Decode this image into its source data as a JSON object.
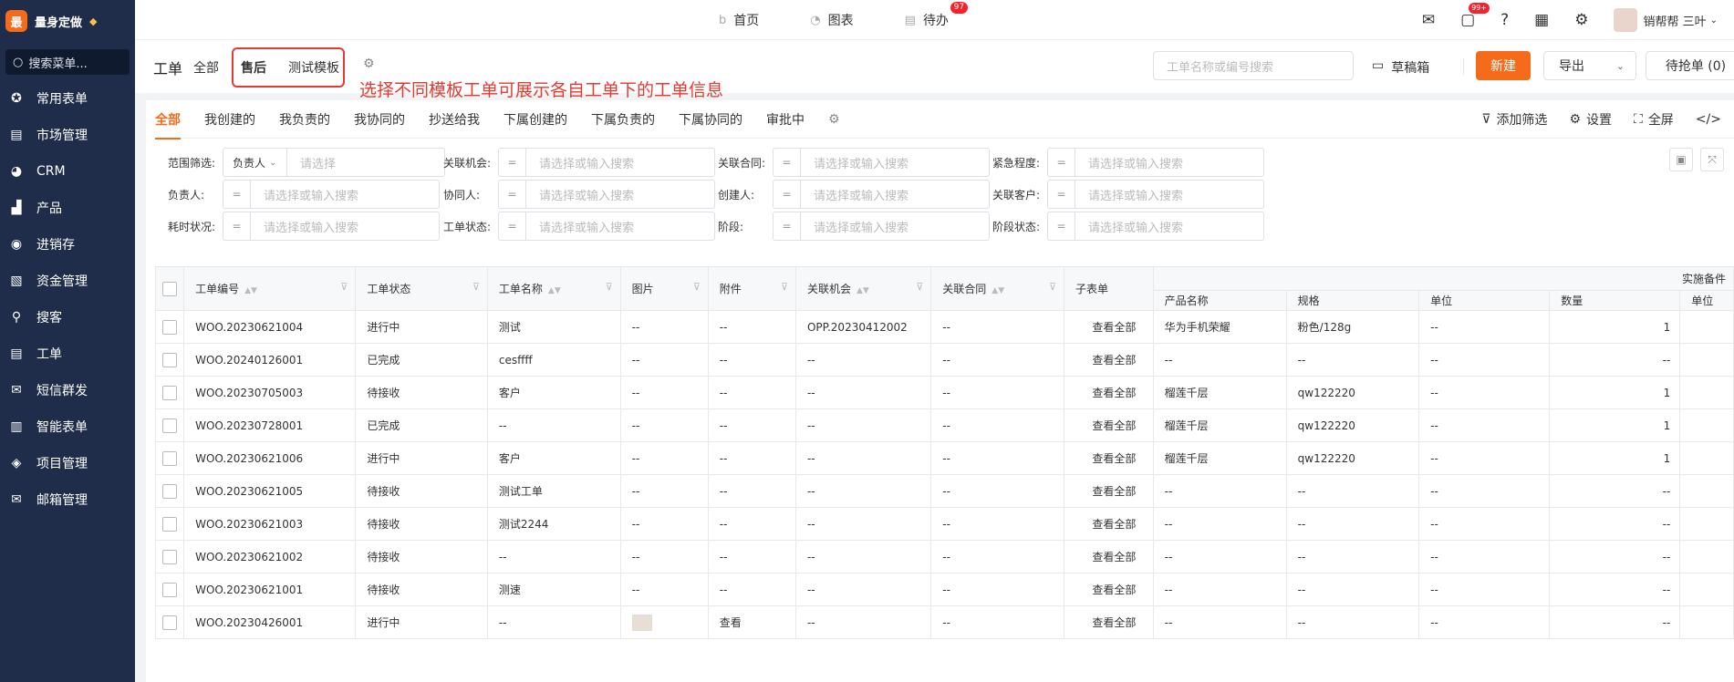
{
  "sidebar": {
    "logo_char": "最",
    "brand": "量身定做",
    "search": "搜索菜单...",
    "items": [
      {
        "label": "常用表单",
        "icon": "star-icon"
      },
      {
        "label": "市场管理",
        "icon": "clipboard-icon"
      },
      {
        "label": "CRM",
        "icon": "pie-icon"
      },
      {
        "label": "产品",
        "icon": "box-icon"
      },
      {
        "label": "进销存",
        "icon": "inventory-icon"
      },
      {
        "label": "资金管理",
        "icon": "finance-icon"
      },
      {
        "label": "搜客",
        "icon": "search-icon"
      },
      {
        "label": "工单",
        "icon": "ticket-icon"
      },
      {
        "label": "短信群发",
        "icon": "sms-icon"
      },
      {
        "label": "智能表单",
        "icon": "form-icon"
      },
      {
        "label": "项目管理",
        "icon": "layers-icon"
      },
      {
        "label": "邮箱管理",
        "icon": "mail-icon"
      }
    ]
  },
  "topnav": {
    "home": "首页",
    "chart": "图表",
    "todo": "待办",
    "todo_badge": "97"
  },
  "topright": {
    "msg_badge": "99+",
    "user": "销帮帮 三叶"
  },
  "header": {
    "title": "工单",
    "all": "全部",
    "tab_active": "售后",
    "tab_test": "测试模板",
    "annotation": "选择不同模板工单可展示各自工单下的工单信息",
    "search_placeholder": "工单名称或编号搜索",
    "draft": "草稿箱",
    "new": "新建",
    "export": "导出",
    "grab": "待抢单 (0)"
  },
  "tabs": [
    "全部",
    "我创建的",
    "我负责的",
    "我协同的",
    "抄送给我",
    "下属创建的",
    "下属负责的",
    "下属协同的",
    "审批中"
  ],
  "tabs_right": {
    "filter": "添加筛选",
    "settings": "设置",
    "fullscreen": "全屏"
  },
  "filters": {
    "scope_label": "范围筛选:",
    "scope_select": "负责人",
    "scope_placeholder": "请选择",
    "op": "=",
    "placeholder": "请选择或输入搜索",
    "labels": [
      "关联机会:",
      "关联合同:",
      "紧急程度:",
      "负责人:",
      "协同人:",
      "创建人:",
      "关联客户:",
      "耗时状况:",
      "工单状态:",
      "阶段:",
      "阶段状态:"
    ]
  },
  "table": {
    "group_header": "实施备件",
    "headers": [
      "工单编号",
      "工单状态",
      "工单名称",
      "图片",
      "附件",
      "关联机会",
      "关联合同",
      "子表单",
      "产品名称",
      "规格",
      "单位",
      "数量",
      "单位"
    ],
    "rows": [
      {
        "id": "WOO.20230621004",
        "status": "进行中",
        "name": "测试",
        "img": "--",
        "att": "--",
        "opp": "OPP.20230412002",
        "contract": "--",
        "sub": "查看全部",
        "product": "华为手机荣耀",
        "spec": "粉色/128g",
        "unit": "--",
        "qty": "1"
      },
      {
        "id": "WOO.20240126001",
        "status": "已完成",
        "name": "cesffff",
        "img": "--",
        "att": "--",
        "opp": "--",
        "contract": "--",
        "sub": "查看全部",
        "product": "--",
        "spec": "--",
        "unit": "--",
        "qty": "--"
      },
      {
        "id": "WOO.20230705003",
        "status": "待接收",
        "name": "客户",
        "img": "--",
        "att": "--",
        "opp": "--",
        "contract": "--",
        "sub": "查看全部",
        "product": "榴莲千层",
        "spec": "qw122220",
        "unit": "--",
        "qty": "1"
      },
      {
        "id": "WOO.20230728001",
        "status": "已完成",
        "name": "--",
        "img": "--",
        "att": "--",
        "opp": "--",
        "contract": "--",
        "sub": "查看全部",
        "product": "榴莲千层",
        "spec": "qw122220",
        "unit": "--",
        "qty": "1"
      },
      {
        "id": "WOO.20230621006",
        "status": "进行中",
        "name": "客户",
        "img": "--",
        "att": "--",
        "opp": "--",
        "contract": "--",
        "sub": "查看全部",
        "product": "榴莲千层",
        "spec": "qw122220",
        "unit": "--",
        "qty": "1"
      },
      {
        "id": "WOO.20230621005",
        "status": "待接收",
        "name": "测试工单",
        "img": "--",
        "att": "--",
        "opp": "--",
        "contract": "--",
        "sub": "查看全部",
        "product": "--",
        "spec": "--",
        "unit": "--",
        "qty": "--"
      },
      {
        "id": "WOO.20230621003",
        "status": "待接收",
        "name": "测试2244",
        "img": "--",
        "att": "--",
        "opp": "--",
        "contract": "--",
        "sub": "查看全部",
        "product": "--",
        "spec": "--",
        "unit": "--",
        "qty": "--"
      },
      {
        "id": "WOO.20230621002",
        "status": "待接收",
        "name": "--",
        "img": "--",
        "att": "--",
        "opp": "--",
        "contract": "--",
        "sub": "查看全部",
        "product": "--",
        "spec": "--",
        "unit": "--",
        "qty": "--"
      },
      {
        "id": "WOO.20230621001",
        "status": "待接收",
        "name": "测速",
        "img": "--",
        "att": "--",
        "opp": "--",
        "contract": "--",
        "sub": "查看全部",
        "product": "--",
        "spec": "--",
        "unit": "--",
        "qty": "--"
      },
      {
        "id": "WOO.20230426001",
        "status": "进行中",
        "name": "--",
        "img": "",
        "att": "查看",
        "opp": "--",
        "contract": "--",
        "sub": "查看全部",
        "product": "--",
        "spec": "--",
        "unit": "--",
        "qty": "--"
      }
    ]
  },
  "colors": {
    "accent": "#f56b1c",
    "sidebar": "#1f2d4a",
    "link": "#1f6fd6",
    "annotation": "#e23b32"
  }
}
